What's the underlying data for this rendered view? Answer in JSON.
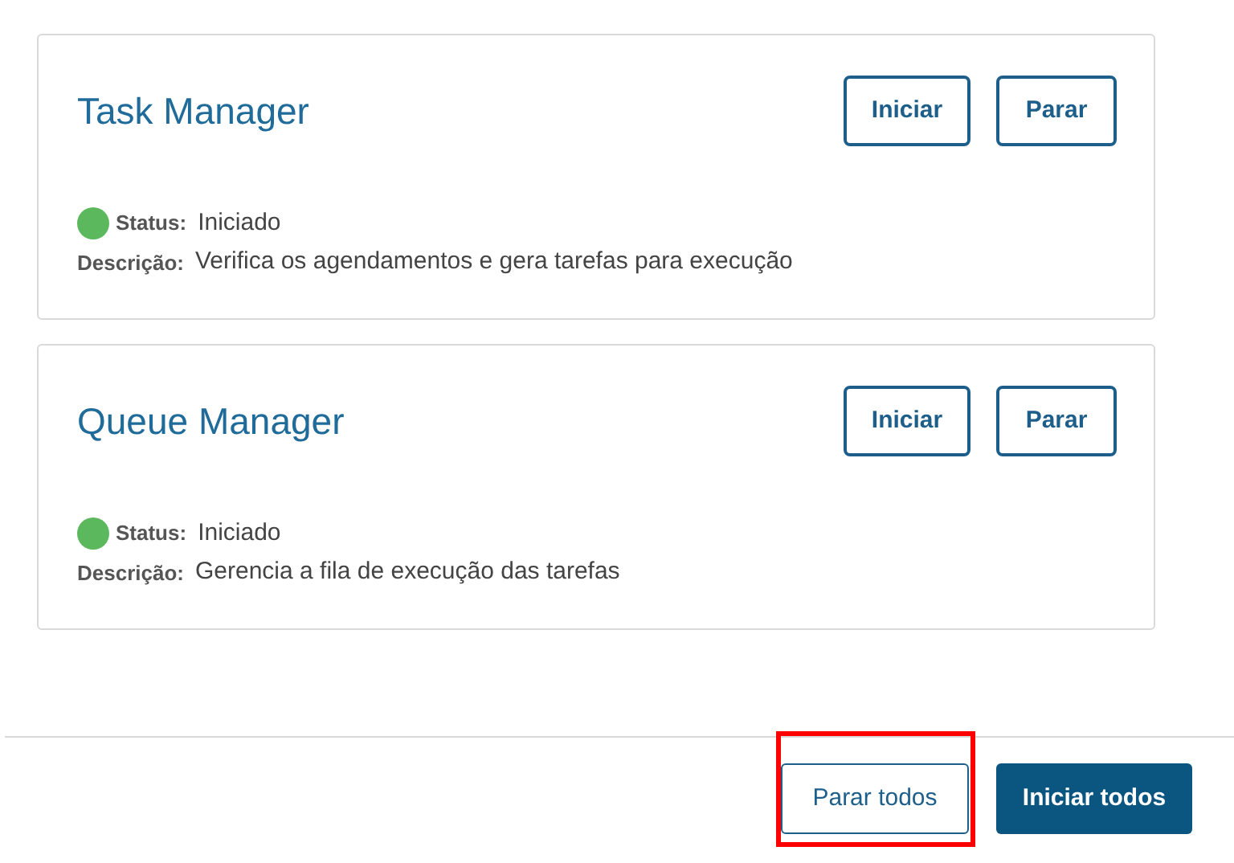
{
  "services": [
    {
      "name": "Task Manager",
      "start_label": "Iniciar",
      "stop_label": "Parar",
      "status_label": "Status:",
      "status": "Iniciado",
      "color": "#5cb85c",
      "description_label": "Descrição:",
      "description": "Verifica os agendamentos e gera tarefas para execução"
    },
    {
      "name": "Queue Manager",
      "start_label": "Iniciar",
      "stop_label": "Parar",
      "status_label": "Status:",
      "status": "Iniciado",
      "color": "#5cb85c",
      "description_label": "Descrição:",
      "description": "Gerencia a fila de execução das tarefas"
    }
  ],
  "footer": {
    "stop_all": "Parar todos",
    "start_all": "Iniciar todos"
  }
}
